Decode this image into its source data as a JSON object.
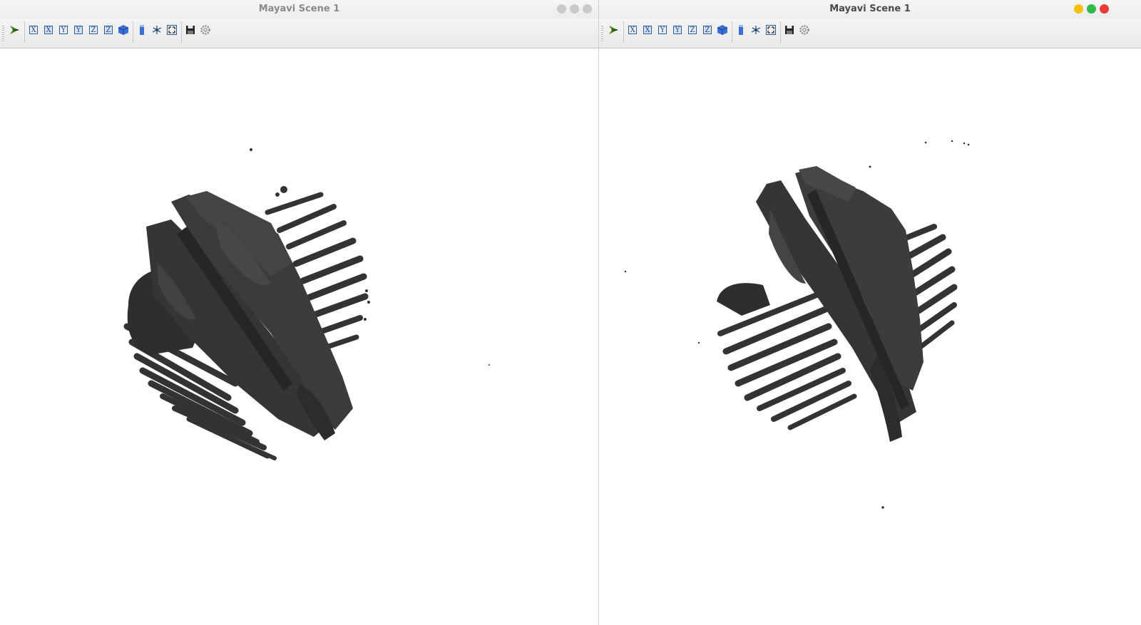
{
  "windows": [
    {
      "title": "Mayavi Scene 1",
      "focused": false,
      "window_buttons": {
        "minimize": "minimize-icon",
        "maximize": "maximize-icon",
        "close": "close-icon"
      }
    },
    {
      "title": "Mayavi Scene 1",
      "focused": true,
      "window_buttons": {
        "minimize": "minimize-icon",
        "maximize": "maximize-icon",
        "close": "close-icon"
      }
    }
  ],
  "toolbar": {
    "axis_buttons": [
      "X",
      "X",
      "Y",
      "Y",
      "Z",
      "Z"
    ],
    "icons": [
      "mayavi-icon",
      "view-plus-x-icon",
      "view-minus-x-icon",
      "view-plus-y-icon",
      "view-minus-y-icon",
      "view-plus-z-icon",
      "view-minus-z-icon",
      "isometric-view-icon",
      "parallel-projection-icon",
      "axes-toggle-icon",
      "fullscreen-icon",
      "save-icon",
      "configure-icon"
    ]
  },
  "colors": {
    "surface": "#333333",
    "surface_highlight": "#4a4a4a",
    "axis_icon": "#2f5d9e",
    "cube_icon": "#3b6fd6",
    "mayavi_icon": "#4a7f1d",
    "close_active": "#ef3a3a",
    "min_active": "#f5c10b",
    "max_active": "#2fb94a",
    "inactive_button": "#c9c9c9"
  }
}
